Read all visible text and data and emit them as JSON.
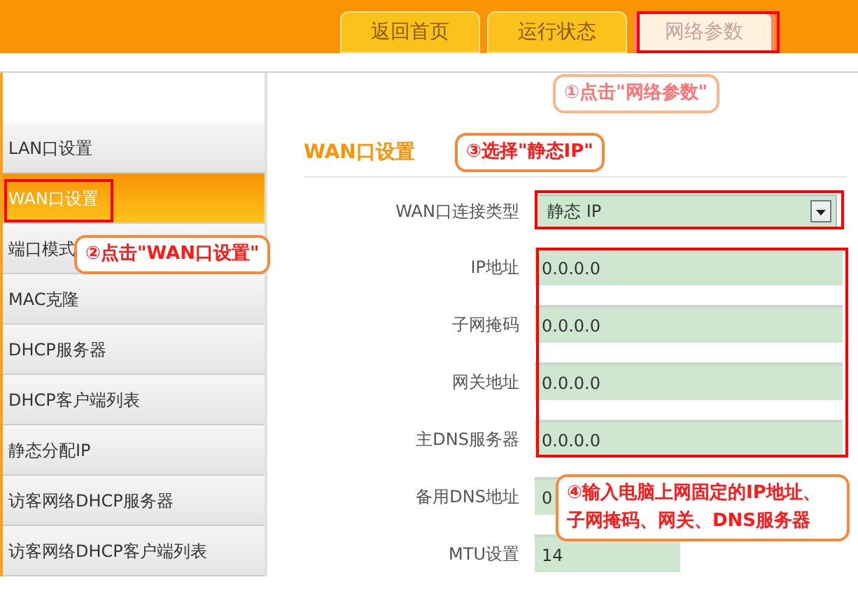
{
  "tabs": [
    {
      "label": "返回首页",
      "selected": false
    },
    {
      "label": "运行状态",
      "selected": false
    },
    {
      "label": "网络参数",
      "selected": true
    }
  ],
  "sidebar": {
    "items": [
      {
        "label": "LAN口设置",
        "selected": false
      },
      {
        "label": "WAN口设置",
        "selected": true
      },
      {
        "label": "端口模式",
        "selected": false
      },
      {
        "label": "MAC克隆",
        "selected": false
      },
      {
        "label": "DHCP服务器",
        "selected": false
      },
      {
        "label": "DHCP客户端列表",
        "selected": false
      },
      {
        "label": "静态分配IP",
        "selected": false
      },
      {
        "label": "访客网络DHCP服务器",
        "selected": false
      },
      {
        "label": "访客网络DHCP客户端列表",
        "selected": false
      }
    ]
  },
  "panel": {
    "title": "WAN口设置",
    "fields": [
      {
        "label": "WAN口连接类型",
        "kind": "select",
        "value": "静态 IP"
      },
      {
        "label": "IP地址",
        "kind": "input",
        "value": "0.0.0.0"
      },
      {
        "label": "子网掩码",
        "kind": "input",
        "value": "0.0.0.0"
      },
      {
        "label": "网关地址",
        "kind": "input",
        "value": "0.0.0.0"
      },
      {
        "label": "主DNS服务器",
        "kind": "input",
        "value": "0.0.0.0"
      },
      {
        "label": "备用DNS地址",
        "kind": "input",
        "value": "0"
      },
      {
        "label": "MTU设置",
        "kind": "short_input",
        "value": "14"
      }
    ]
  },
  "annotations": [
    {
      "text": "①点击\"网络参数\""
    },
    {
      "text": "②点击\"WAN口设置\""
    },
    {
      "text": "③选择\"静态IP\""
    },
    {
      "text": "④输入电脑上网固定的IP地址、子网掩码、网关、DNS服务器"
    }
  ]
}
